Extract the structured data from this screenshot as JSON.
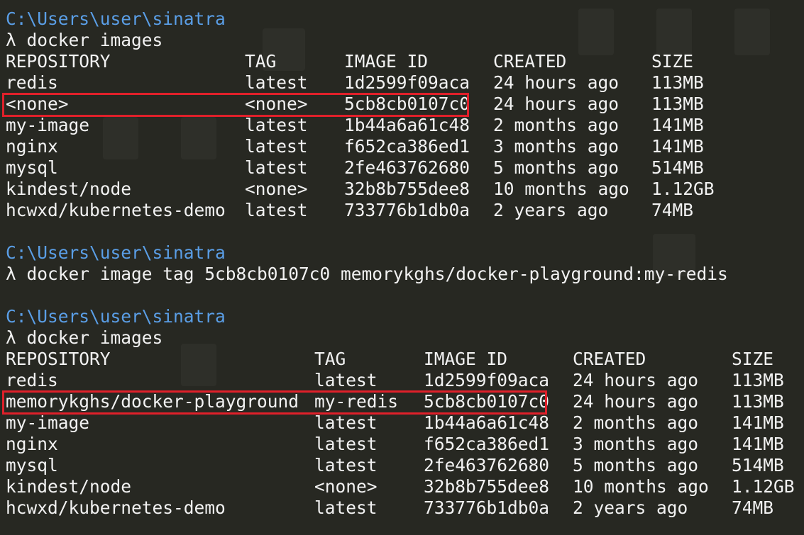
{
  "colors": {
    "background": "#272822",
    "path": "#5a9ee6",
    "text": "#f2f2f2",
    "highlight_box": "#e0202a"
  },
  "block1": {
    "prompt_path": "C:\\Users\\user\\sinatra",
    "command": "λ docker images",
    "headers": [
      "REPOSITORY",
      "TAG",
      "IMAGE ID",
      "CREATED",
      "SIZE"
    ],
    "rows": [
      [
        "redis",
        "latest",
        "1d2599f09aca",
        "24 hours ago",
        "113MB"
      ],
      [
        "<none>",
        "<none>",
        "5cb8cb0107c0",
        "24 hours ago",
        "113MB"
      ],
      [
        "my-image",
        "latest",
        "1b44a6a61c48",
        "2 months ago",
        "141MB"
      ],
      [
        "nginx",
        "latest",
        "f652ca386ed1",
        "3 months ago",
        "141MB"
      ],
      [
        "mysql",
        "latest",
        "2fe463762680",
        "5 months ago",
        "514MB"
      ],
      [
        "kindest/node",
        "<none>",
        "32b8b755dee8",
        "10 months ago",
        "1.12GB"
      ],
      [
        "hcwxd/kubernetes-demo",
        "latest",
        "733776b1db0a",
        "2 years ago",
        "74MB"
      ]
    ]
  },
  "block2": {
    "prompt_path": "C:\\Users\\user\\sinatra",
    "command": "λ docker image tag 5cb8cb0107c0 memorykghs/docker-playground:my-redis"
  },
  "block3": {
    "prompt_path": "C:\\Users\\user\\sinatra",
    "command": "λ docker images",
    "headers": [
      "REPOSITORY",
      "TAG",
      "IMAGE ID",
      "CREATED",
      "SIZE"
    ],
    "rows": [
      [
        "redis",
        "latest",
        "1d2599f09aca",
        "24 hours ago",
        "113MB"
      ],
      [
        "memorykghs/docker-playground",
        "my-redis",
        "5cb8cb0107c0",
        "24 hours ago",
        "113MB"
      ],
      [
        "my-image",
        "latest",
        "1b44a6a61c48",
        "2 months ago",
        "141MB"
      ],
      [
        "nginx",
        "latest",
        "f652ca386ed1",
        "3 months ago",
        "141MB"
      ],
      [
        "mysql",
        "latest",
        "2fe463762680",
        "5 months ago",
        "514MB"
      ],
      [
        "kindest/node",
        "<none>",
        "32b8b755dee8",
        "10 months ago",
        "1.12GB"
      ],
      [
        "hcwxd/kubernetes-demo",
        "latest",
        "733776b1db0a",
        "2 years ago",
        "74MB"
      ]
    ]
  }
}
